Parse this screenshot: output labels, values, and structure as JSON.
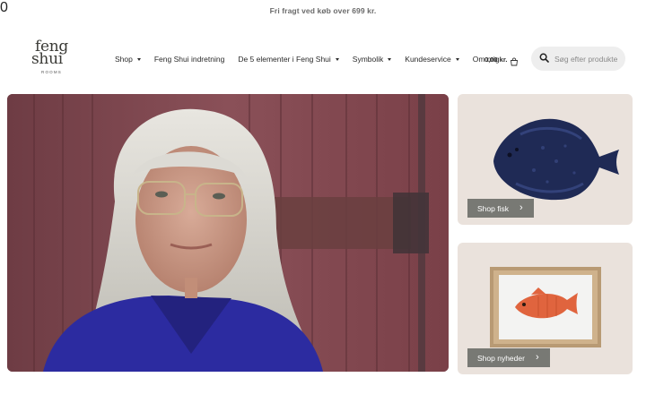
{
  "topbar": {
    "text": "Fri fragt ved køb over 699 kr."
  },
  "logo": {
    "line1": "feng",
    "line2": "shui",
    "line3": "ROOMS"
  },
  "nav": {
    "items": [
      {
        "label": "Shop",
        "has_dropdown": true
      },
      {
        "label": "Feng Shui indretning",
        "has_dropdown": false
      },
      {
        "label": "De 5 elementer i Feng Shui",
        "has_dropdown": true
      },
      {
        "label": "Symbolik",
        "has_dropdown": true
      },
      {
        "label": "Kundeservice",
        "has_dropdown": true
      },
      {
        "label": "Om mig",
        "has_dropdown": false
      }
    ]
  },
  "cart": {
    "amount": "0,00 kr.",
    "count": "0",
    "icon": "shopping-bag-icon"
  },
  "search": {
    "placeholder": "Søg efter produkter",
    "icon": "search-icon"
  },
  "cards": [
    {
      "button_label": "Shop fisk",
      "icon": "chevron-right-icon"
    },
    {
      "button_label": "Shop nyheder",
      "icon": "chevron-right-icon"
    }
  ],
  "colors": {
    "card_bg": "#eae2dc",
    "button_bg": "#6e706a",
    "badge": "#d9534f",
    "search_bg": "#eeeeee"
  }
}
